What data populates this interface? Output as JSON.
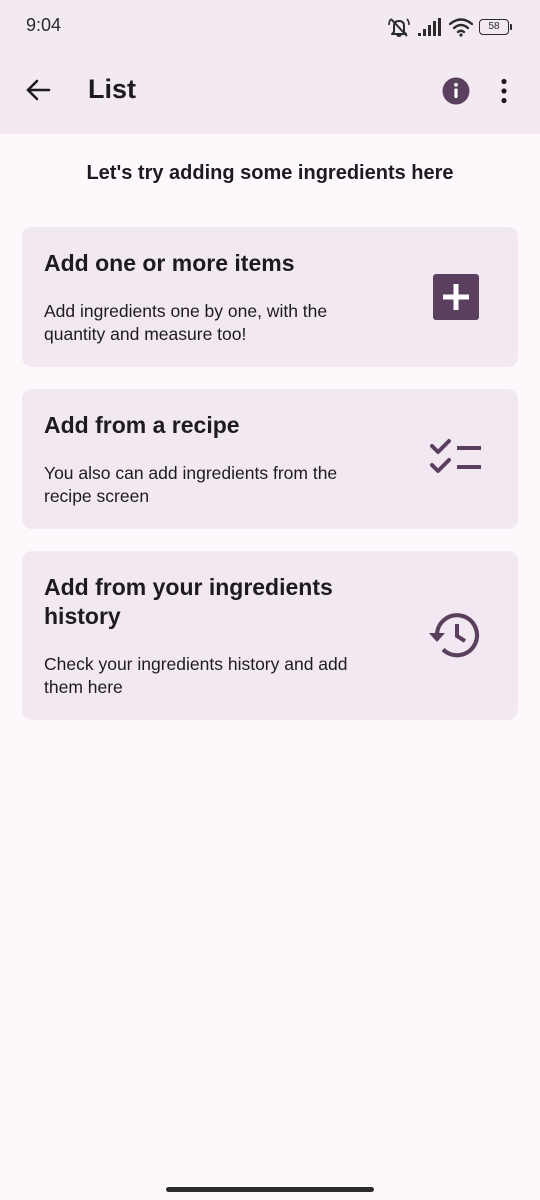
{
  "status_bar": {
    "time": "9:04",
    "battery": "58",
    "icons": [
      "mute-icon",
      "signal-icon",
      "wifi-icon",
      "battery-icon"
    ]
  },
  "app_bar": {
    "title": "List",
    "back_icon": "arrow-back-icon",
    "info_icon": "info-icon",
    "more_icon": "more-vertical-icon"
  },
  "intro": "Let's try adding some ingredients here",
  "cards": [
    {
      "title": "Add one or more items",
      "description": "Add ingredients one by one, with the quantity and measure too!",
      "icon": "add-box-icon"
    },
    {
      "title": "Add from a recipe",
      "description": "You also can add ingredients from the recipe screen",
      "icon": "checklist-icon"
    },
    {
      "title": "Add from your ingredients history",
      "description": "Check your ingredients history and add them here",
      "icon": "history-icon"
    }
  ],
  "colors": {
    "accent": "#5a3f5f",
    "app_bar_bg": "#f3e9f1",
    "card_bg": "#f2e8f1",
    "page_bg": "#fdf8fc"
  }
}
